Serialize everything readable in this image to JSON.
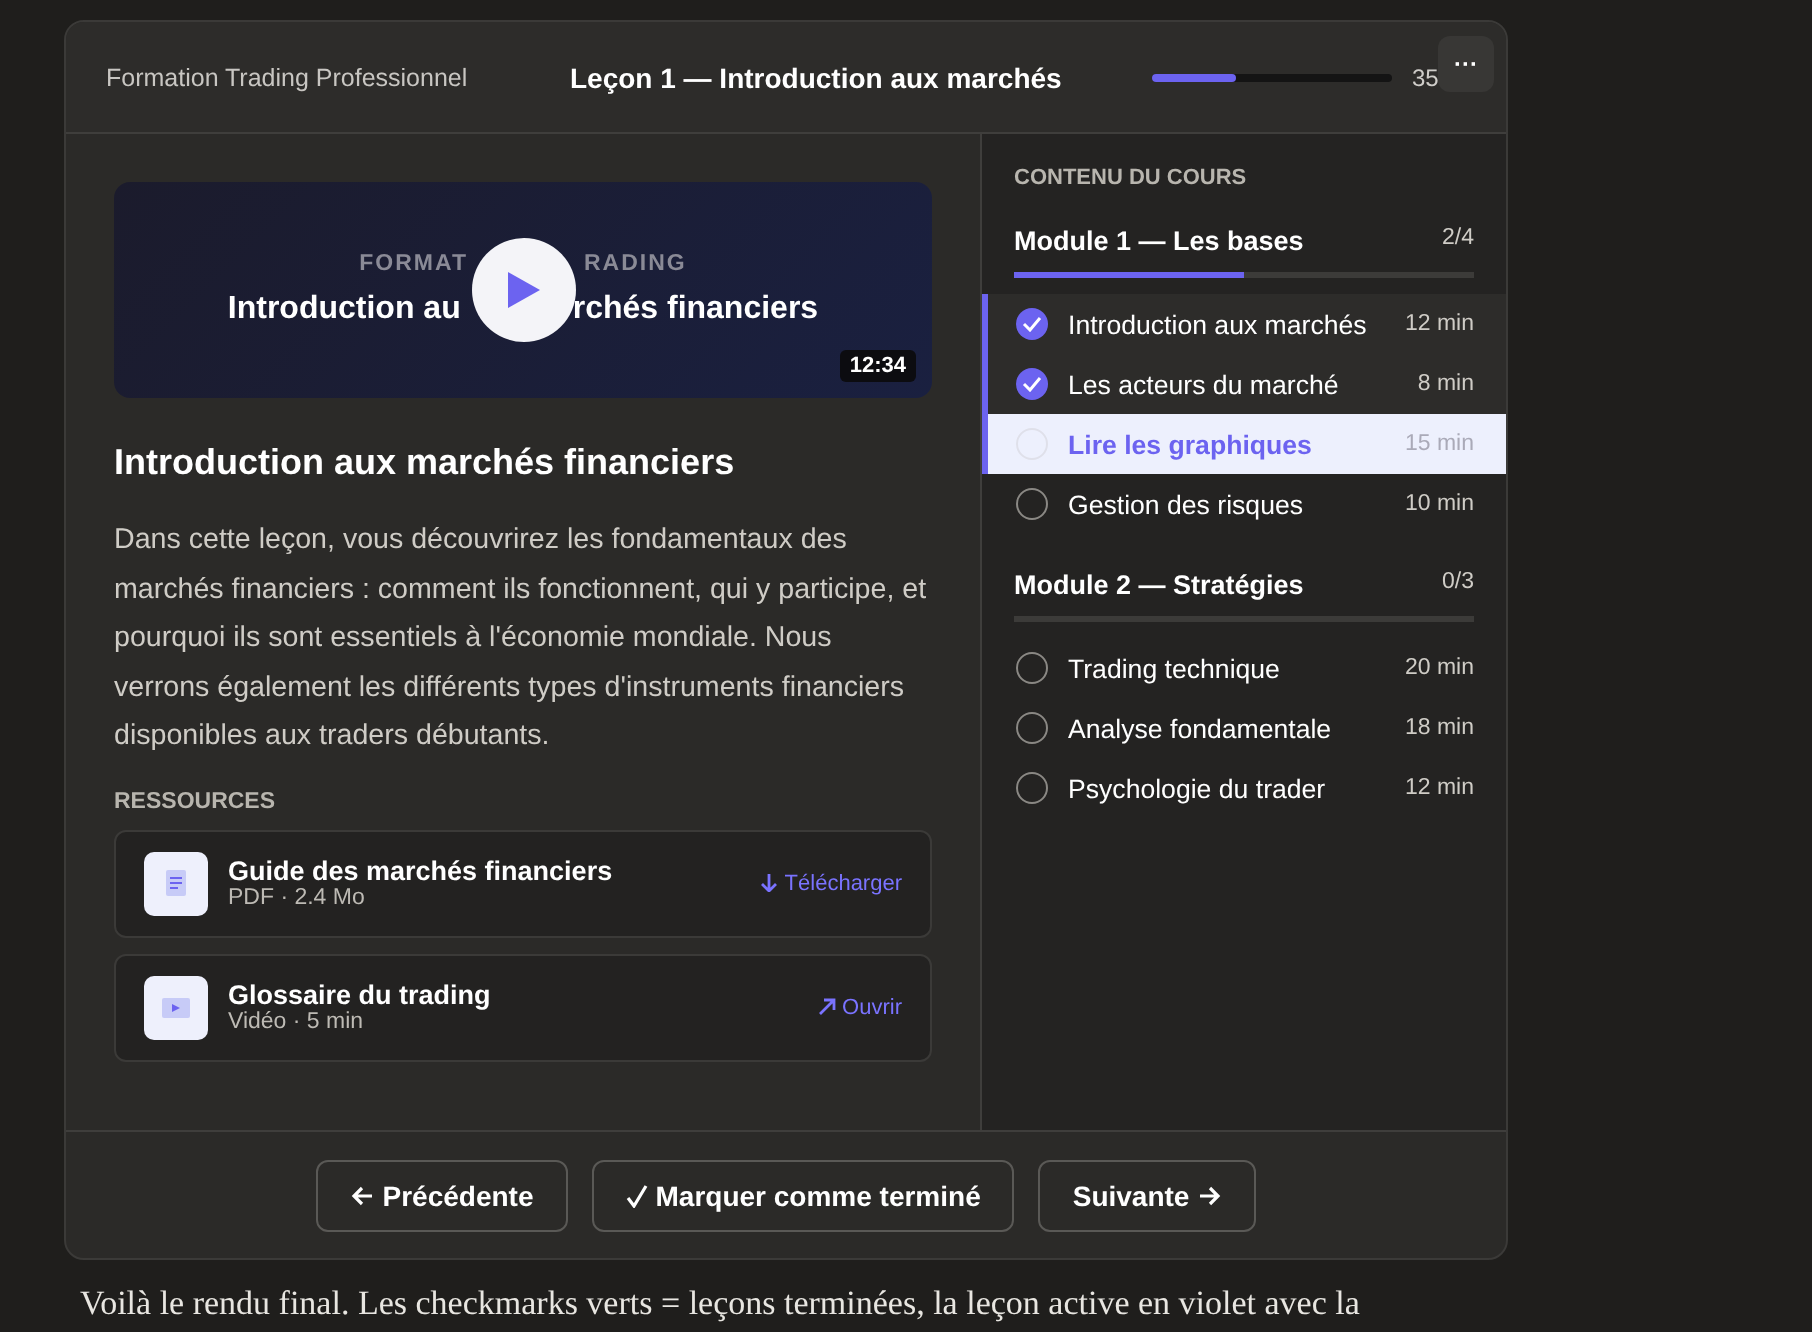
{
  "header": {
    "course": "Formation Trading Professionnel",
    "lesson_title": "Leçon 1 — Introduction aux marchés",
    "progress": {
      "level": 0.35,
      "reading": "35"
    },
    "menu_button": "···"
  },
  "video": {
    "kicker": [
      "FORMAT",
      "RADING"
    ],
    "title": [
      "Introduction au",
      "rchés financiers"
    ],
    "duration": "12:34"
  },
  "lesson": {
    "title": "Introduction aux marchés financiers",
    "description": "Dans cette leçon, vous découvrirez les fondamentaux des marchés financiers : comment ils fonctionnent, qui y participe, et pourquoi ils sont essentiels à l'économie mondiale. Nous verrons également les différents types d'instruments financiers disponibles aux traders débutants."
  },
  "resources": {
    "heading": "RESSOURCES",
    "items": [
      {
        "kind": "document",
        "name": "Guide des marchés financiers",
        "meta": "PDF · 2.4 Mo",
        "action": "Télécharger"
      },
      {
        "kind": "video",
        "name": "Glossaire du trading",
        "meta": "Vidéo · 5 min",
        "action": "Ouvrir"
      }
    ]
  },
  "sidebar": {
    "heading": "CONTENU DU COURS",
    "modules": [
      {
        "title": "Module 1 — Les bases",
        "count": "2/4",
        "level": 0.5,
        "lessons": [
          {
            "title": "Introduction aux marchés",
            "duration": "12 min",
            "checked": true,
            "selected": false
          },
          {
            "title": "Les acteurs du marché",
            "duration": "8 min",
            "checked": true,
            "selected": false
          },
          {
            "title": "Lire les graphiques",
            "duration": "15 min",
            "checked": false,
            "selected": true
          },
          {
            "title": "Gestion des risques",
            "duration": "10 min",
            "checked": false,
            "selected": false
          }
        ]
      },
      {
        "title": "Module 2 — Stratégies",
        "count": "0/3",
        "lessons": [
          {
            "title": "Trading technique",
            "duration": "20 min",
            "checked": false,
            "selected": false
          },
          {
            "title": "Analyse fondamentale",
            "duration": "18 min",
            "checked": false,
            "selected": false
          },
          {
            "title": "Psychologie du trader",
            "duration": "12 min",
            "checked": false,
            "selected": false
          }
        ]
      }
    ]
  },
  "footer": {
    "buttons": [
      {
        "kind": "prev",
        "label": "Précédente"
      },
      {
        "kind": "complete",
        "label": "Marquer comme terminé"
      },
      {
        "kind": "next",
        "label": "Suivante"
      }
    ]
  },
  "caption": "Voilà le rendu final. Les checkmarks verts = leçons terminées, la leçon active en violet avec la"
}
